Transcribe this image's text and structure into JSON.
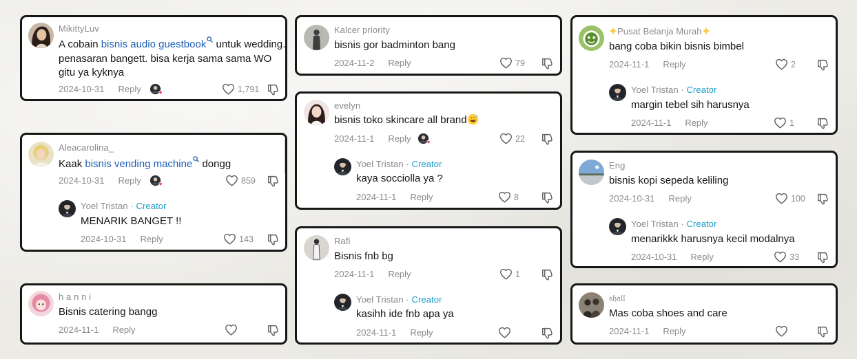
{
  "comments": [
    {
      "username": "MikittyLuv",
      "text_before": "A cobain ",
      "link_text": "bisnis audio guestbook",
      "text_after": " untuk wedding. penasaran bangett. bisa kerja sama sama WO gitu ya kyknya",
      "date": "2024-10-31",
      "reply": "Reply",
      "likes": "1,791"
    },
    {
      "username": "Aleacarolina_",
      "text_before": "Kaak ",
      "link_text": "bisnis vending machine",
      "text_after": " dongg",
      "date": "2024-10-31",
      "reply": "Reply",
      "likes": "859",
      "creator_reply": {
        "username": "Yoel Tristan",
        "sep": " · ",
        "badge": "Creator",
        "text": "MENARIK BANGET !!",
        "date": "2024-10-31",
        "reply": "Reply",
        "likes": "143"
      }
    },
    {
      "username": "h a n n i",
      "text": "Bisnis catering bangg",
      "date": "2024-11-1",
      "reply": "Reply",
      "likes": ""
    },
    {
      "username": "Kalcer priority",
      "text": "bisnis gor badminton bang",
      "date": "2024-11-2",
      "reply": "Reply",
      "likes": "79"
    },
    {
      "username": "evelyn",
      "text": "bisnis toko skincare all brand",
      "date": "2024-11-1",
      "reply": "Reply",
      "likes": "22",
      "creator_reply": {
        "username": "Yoel Tristan",
        "sep": " · ",
        "badge": "Creator",
        "text": "kaya socciolla ya ?",
        "date": "2024-11-1",
        "reply": "Reply",
        "likes": "8"
      }
    },
    {
      "username": "Rafi",
      "text": "Bisnis fnb bg",
      "date": "2024-11-1",
      "reply": "Reply",
      "likes": "1",
      "creator_reply": {
        "username": "Yoel Tristan",
        "sep": " · ",
        "badge": "Creator",
        "text": "kasihh ide fnb apa ya",
        "date": "2024-11-1",
        "reply": "Reply",
        "likes": ""
      }
    },
    {
      "username": "Pusat Belanja Murah",
      "text": "bang coba bikin bisnis bimbel",
      "date": "2024-11-1",
      "reply": "Reply",
      "likes": "2",
      "creator_reply": {
        "username": "Yoel Tristan",
        "sep": " · ",
        "badge": "Creator",
        "text": "margin tebel sih harusnya",
        "date": "2024-11-1",
        "reply": "Reply",
        "likes": "1"
      }
    },
    {
      "username": "Eng",
      "text": "bisnis kopi sepeda keliling",
      "date": "2024-10-31",
      "reply": "Reply",
      "likes": "100",
      "creator_reply": {
        "username": "Yoel Tristan",
        "sep": " · ",
        "badge": "Creator",
        "text": "menarikkk harusnya kecil modalnya",
        "date": "2024-10-31",
        "reply": "Reply",
        "likes": "33"
      }
    },
    {
      "username": "𝔰𝔥𝔞𝔩𝔩",
      "text": "Mas coba shoes and care",
      "date": "2024-11-1",
      "reply": "Reply",
      "likes": ""
    }
  ],
  "colors": {
    "creator": "#1a9fc9",
    "link": "#1e5fb5",
    "meta": "#8a8a8a",
    "border": "#161616"
  },
  "icons": [
    "heart-outline-icon",
    "dislike-icon",
    "search-icon",
    "liked-by-creator-icon",
    "sparkle-icon",
    "grinning-sweat-emoji"
  ]
}
